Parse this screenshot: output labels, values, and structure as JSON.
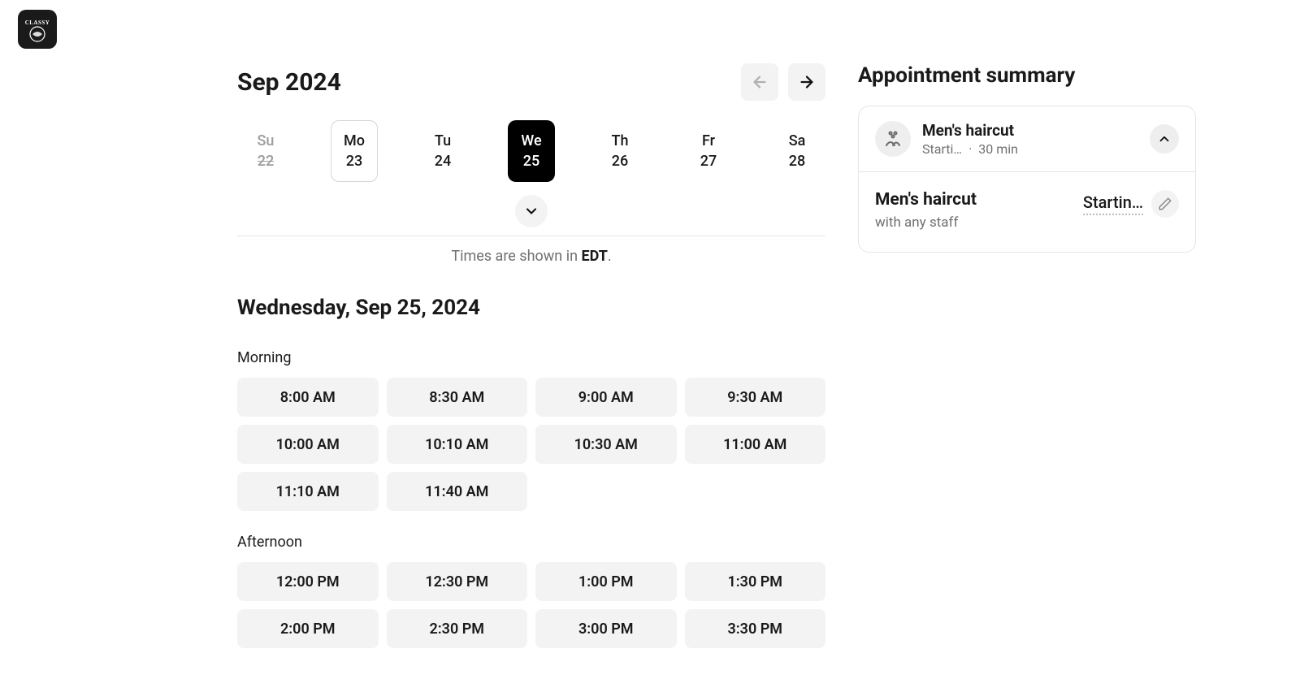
{
  "month_label": "Sep 2024",
  "days": [
    {
      "dow": "Su",
      "num": "22",
      "state": "disabled"
    },
    {
      "dow": "Mo",
      "num": "23",
      "state": "outlined"
    },
    {
      "dow": "Tu",
      "num": "24",
      "state": "normal"
    },
    {
      "dow": "We",
      "num": "25",
      "state": "selected"
    },
    {
      "dow": "Th",
      "num": "26",
      "state": "normal"
    },
    {
      "dow": "Fr",
      "num": "27",
      "state": "normal"
    },
    {
      "dow": "Sa",
      "num": "28",
      "state": "normal"
    }
  ],
  "tz_prefix": "Times are shown in ",
  "tz_code": "EDT",
  "tz_suffix": ".",
  "date_title": "Wednesday, Sep 25, 2024",
  "morning_label": "Morning",
  "morning_slots": [
    "8:00 AM",
    "8:30 AM",
    "9:00 AM",
    "9:30 AM",
    "10:00 AM",
    "10:10 AM",
    "10:30 AM",
    "11:00 AM",
    "11:10 AM",
    "11:40 AM"
  ],
  "afternoon_label": "Afternoon",
  "afternoon_slots": [
    "12:00 PM",
    "12:30 PM",
    "1:00 PM",
    "1:30 PM",
    "2:00 PM",
    "2:30 PM",
    "3:00 PM",
    "3:30 PM"
  ],
  "summary_title": "Appointment summary",
  "summary": {
    "top": {
      "name": "Men's haircut",
      "price_truncated": "Starti…",
      "dot": "·",
      "duration": "30 min"
    },
    "bottom": {
      "name": "Men's haircut",
      "staff": "with any staff",
      "price_truncated": "Startin…"
    }
  }
}
